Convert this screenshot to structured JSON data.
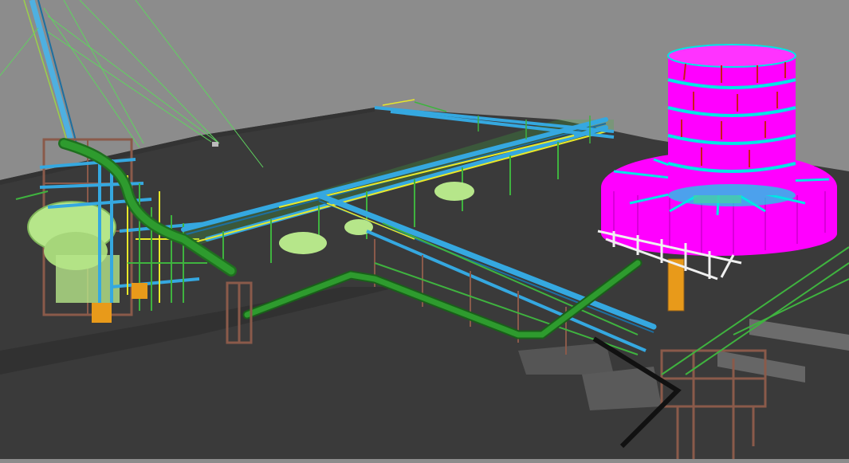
{
  "viewport": {
    "description_visible_text": "",
    "colors": {
      "sky": "#8c8c8c",
      "ground_plane": "#3a3a3a",
      "ground_edge": "#262626",
      "pipe_blue": "#35a8e0",
      "pipe_green": "#2e8b2e",
      "steel_brown": "#8a5a4a",
      "steel_green": "#3fb33f",
      "tank_magenta": "#ff00ff",
      "tank_cyan": "#00e5e5",
      "vessel_lightgreen": "#b6e68a",
      "yellow_line": "#e8e82a",
      "white_frame": "#f0f0f0",
      "orange_part": "#e89a1a"
    }
  }
}
